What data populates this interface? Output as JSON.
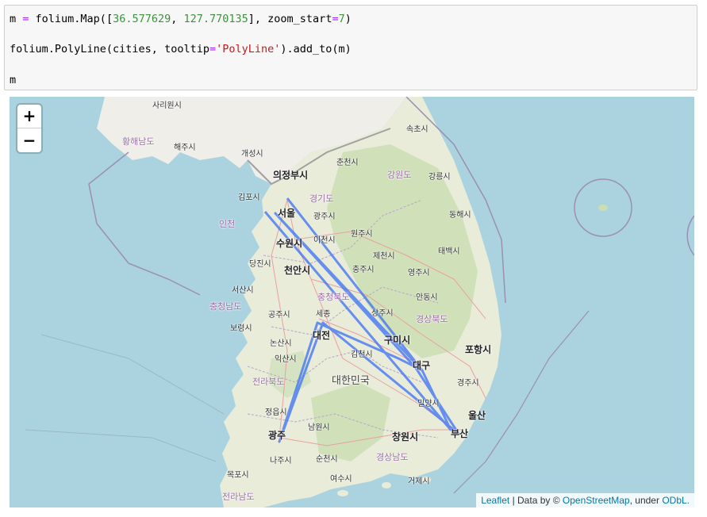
{
  "code": {
    "line1": {
      "a": "m ",
      "op": "=",
      "b": " folium.Map([",
      "n1": "36.577629",
      "c": ", ",
      "n2": "127.770135",
      "d": "], zoom_start",
      "op2": "=",
      "n3": "7",
      "e": ")"
    },
    "line2": {
      "a": "folium.PolyLine(cities, tooltip",
      "op": "=",
      "s": "'PolyLine'",
      "b": ").add_to(m)"
    },
    "line3": "m"
  },
  "map": {
    "zoom_in": "+",
    "zoom_out": "−",
    "attribution": {
      "leaflet": "Leaflet",
      "sep": " | Data by © ",
      "osm": "OpenStreetMap",
      "under": ", under ",
      "odbl": "ODbL."
    },
    "labels": {
      "sariwon": "사리원시",
      "hwanghae": "황해남도",
      "haeju": "해주시",
      "kaesong": "개성시",
      "sokcho": "속초시",
      "chuncheon": "춘천시",
      "uijeongbu": "의정부시",
      "gangwon": "강원도",
      "gangneung": "강릉시",
      "gimpo": "김포시",
      "gyeonggi": "경기도",
      "seoul": "서울",
      "incheon": "인천",
      "gwangju_gg": "광주시",
      "donghae": "동해시",
      "suwon": "수원시",
      "icheon": "이천시",
      "wonju": "원주시",
      "dangjin": "당진시",
      "jecheon": "제천시",
      "taebaek": "태백시",
      "cheonan": "천안시",
      "chungju": "충주시",
      "yeongju": "영주시",
      "seosan": "서산시",
      "chungbuk": "충청북도",
      "andong": "안동시",
      "chungnam": "충청남도",
      "gongju": "공주시",
      "sejong": "세종",
      "sangju": "상주시",
      "gyeongbuk": "경상북도",
      "boryeong": "보령시",
      "daejeon": "대전",
      "gumi": "구미시",
      "nonsan": "논산시",
      "gimcheon": "김천시",
      "pohang": "포항시",
      "iksan": "익산시",
      "daegu": "대구",
      "jeonbuk": "전라북도",
      "korea": "대한민국",
      "gyeongju": "경주시",
      "miryang": "밀양시",
      "jeongeup": "정읍시",
      "ulsan": "울산",
      "namwon": "남원시",
      "gwangju": "광주",
      "changwon": "창원시",
      "busan": "부산",
      "naju": "나주시",
      "suncheon": "순천시",
      "gyeongnam": "경상남도",
      "geoje": "거제시",
      "mokpo": "목포시",
      "yeosu": "여수시",
      "jeonnam": "전라남도"
    },
    "polyline_color": "#3b6ff5"
  }
}
